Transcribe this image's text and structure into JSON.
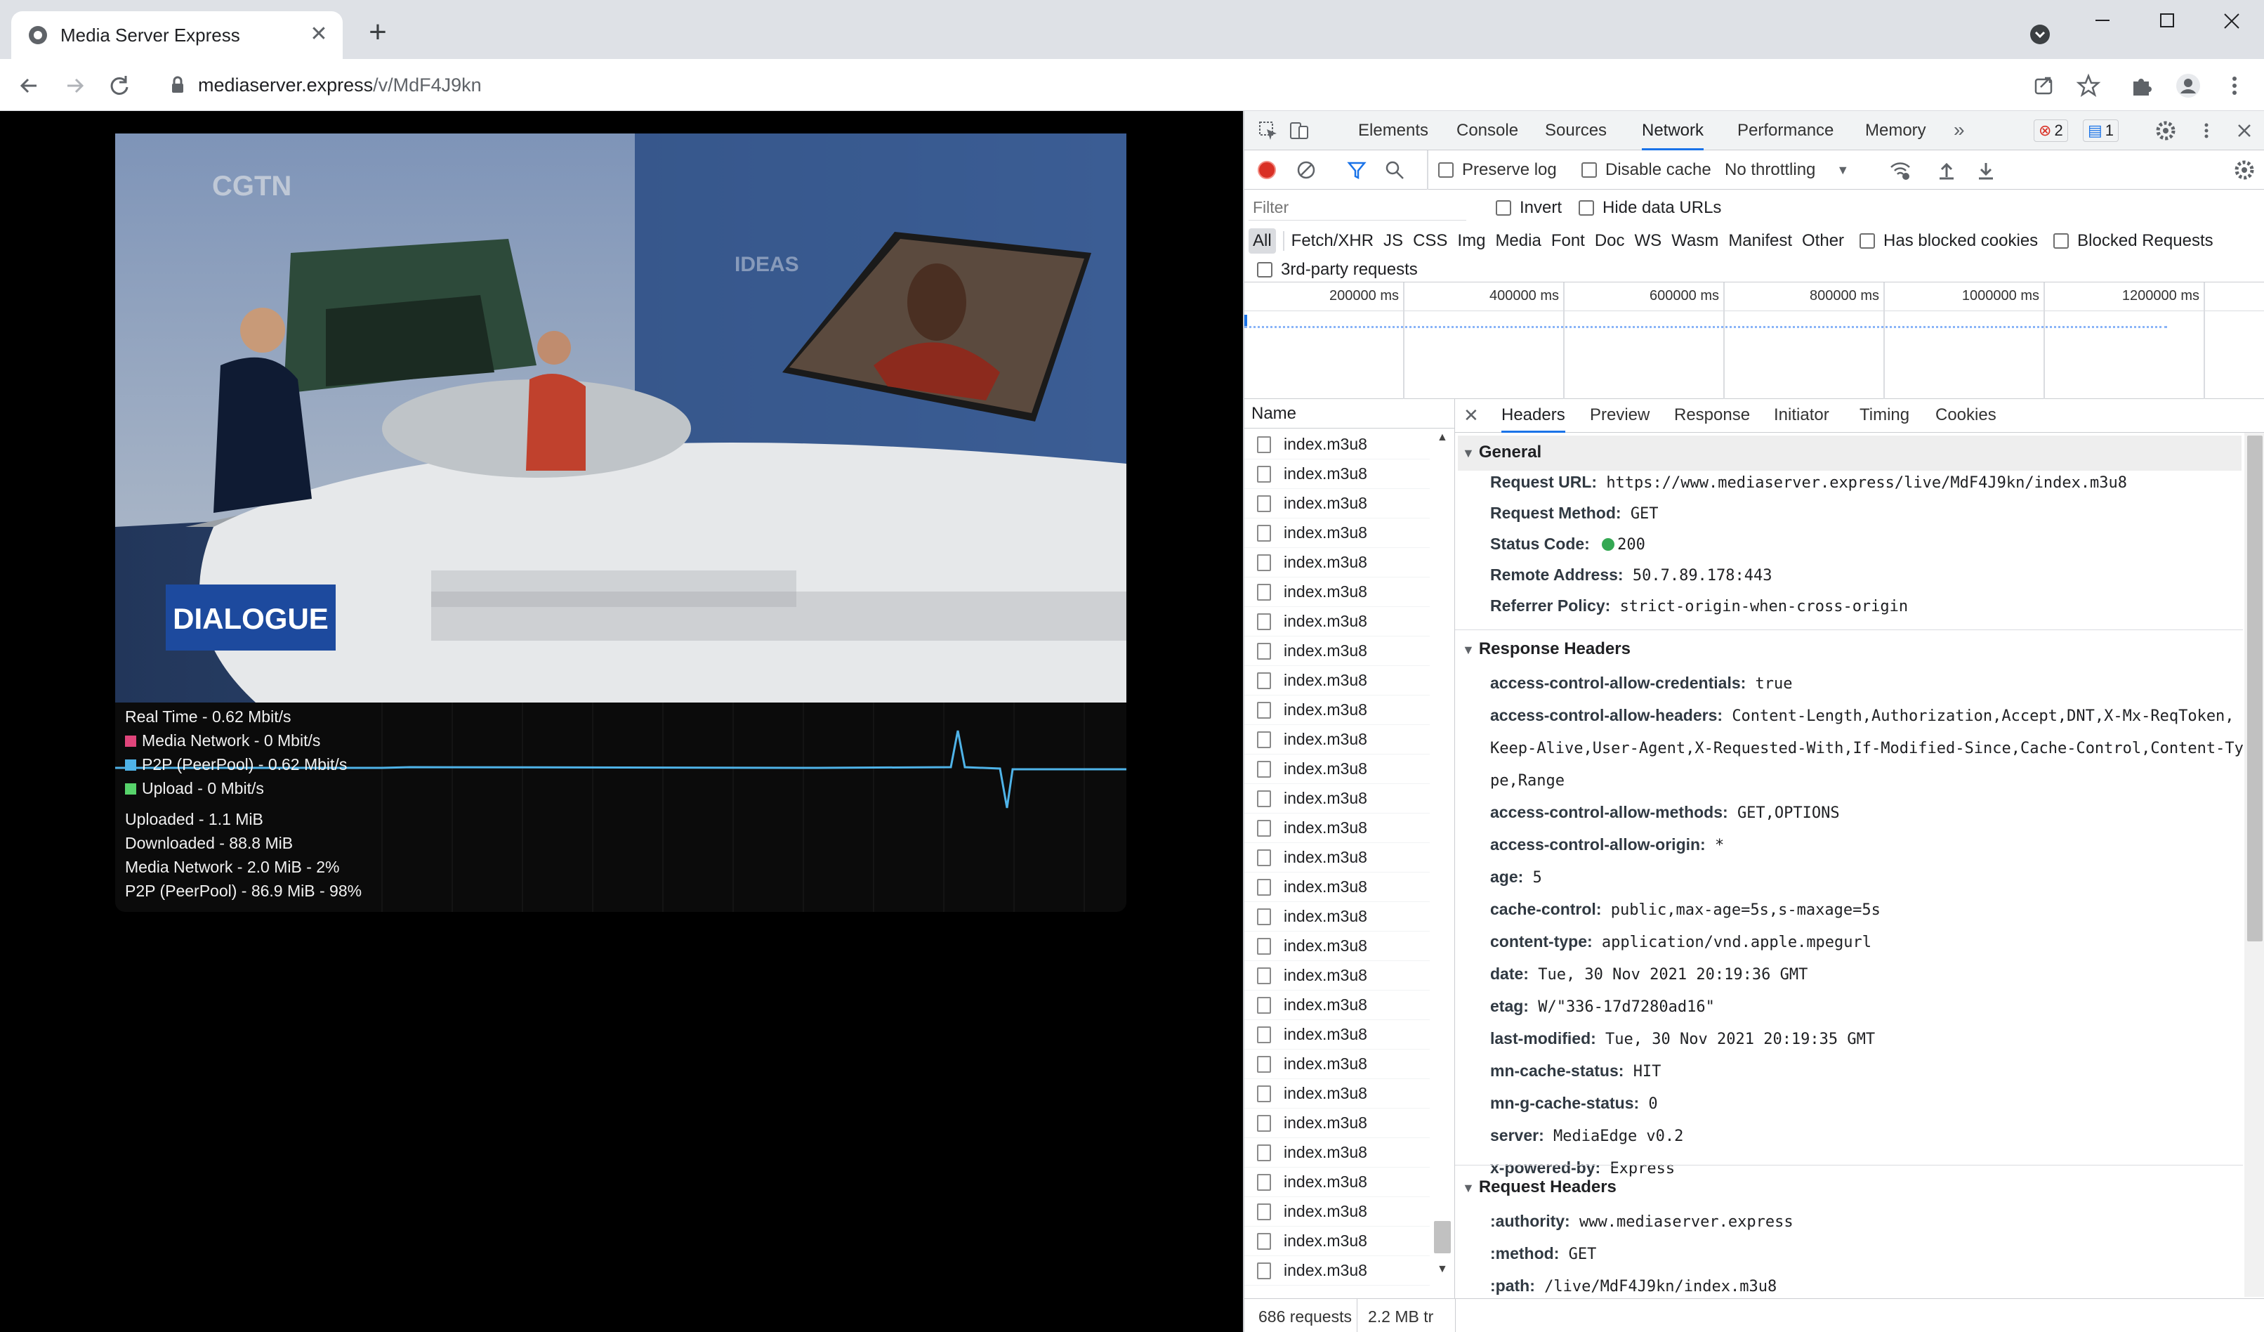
{
  "browser": {
    "tab_title": "Media Server Express",
    "url_host": "mediaserver.express",
    "url_path": "/v/MdF4J9kn"
  },
  "video": {
    "channel_logo": "CGTN",
    "background_text": "IDEAS",
    "program_badge": "DIALOGUE"
  },
  "stats": {
    "real_time": "Real Time - 0.62 Mbit/s",
    "media_network": "Media Network - 0 Mbit/s",
    "p2p": "P2P (PeerPool) - 0.62 Mbit/s",
    "upload": "Upload - 0 Mbit/s",
    "uploaded": "Uploaded - 1.1 MiB",
    "downloaded": "Downloaded - 88.8 MiB",
    "media_total": "Media Network - 2.0 MiB - 2%",
    "p2p_total": "P2P (PeerPool) - 86.9 MiB - 98%",
    "colors": {
      "media": "#e0457b",
      "p2p": "#4fb3e8",
      "upload": "#57d36b"
    }
  },
  "devtools": {
    "tabs": [
      "Elements",
      "Console",
      "Sources",
      "Network",
      "Performance",
      "Memory"
    ],
    "active_tab": "Network",
    "error_count": "2",
    "message_count": "1",
    "toolbar": {
      "preserve_log": "Preserve log",
      "disable_cache": "Disable cache",
      "throttling": "No throttling"
    },
    "filter": {
      "placeholder": "Filter",
      "invert": "Invert",
      "hide_data_urls": "Hide data URLs",
      "types": [
        "All",
        "Fetch/XHR",
        "JS",
        "CSS",
        "Img",
        "Media",
        "Font",
        "Doc",
        "WS",
        "Wasm",
        "Manifest",
        "Other"
      ],
      "has_blocked_cookies": "Has blocked cookies",
      "blocked_requests": "Blocked Requests",
      "third_party": "3rd-party requests"
    },
    "timeline_ticks": [
      "200000 ms",
      "400000 ms",
      "600000 ms",
      "800000 ms",
      "1000000 ms",
      "1200000 ms"
    ],
    "name_header": "Name",
    "request_name": "index.m3u8",
    "detail_tabs": [
      "Headers",
      "Preview",
      "Response",
      "Initiator",
      "Timing",
      "Cookies"
    ],
    "general": {
      "title": "General",
      "request_url_k": "Request URL:",
      "request_url_v": "https://www.mediaserver.express/live/MdF4J9kn/index.m3u8",
      "method_k": "Request Method:",
      "method_v": "GET",
      "status_k": "Status Code:",
      "status_v": "200",
      "remote_k": "Remote Address:",
      "remote_v": "50.7.89.178:443",
      "referrer_k": "Referrer Policy:",
      "referrer_v": "strict-origin-when-cross-origin"
    },
    "response_headers": {
      "title": "Response Headers",
      "rows": [
        {
          "k": "access-control-allow-credentials:",
          "v": "true"
        },
        {
          "k": "access-control-allow-headers:",
          "v": "Content-Length,Authorization,Accept,DNT,X-Mx-ReqToken,"
        },
        {
          "k": "",
          "v": "Keep-Alive,User-Agent,X-Requested-With,If-Modified-Since,Cache-Control,Content-Ty"
        },
        {
          "k": "",
          "v": "pe,Range"
        },
        {
          "k": "access-control-allow-methods:",
          "v": "GET,OPTIONS"
        },
        {
          "k": "access-control-allow-origin:",
          "v": "*"
        },
        {
          "k": "age:",
          "v": "5"
        },
        {
          "k": "cache-control:",
          "v": "public,max-age=5s,s-maxage=5s"
        },
        {
          "k": "content-type:",
          "v": "application/vnd.apple.mpegurl"
        },
        {
          "k": "date:",
          "v": "Tue, 30 Nov 2021 20:19:36 GMT"
        },
        {
          "k": "etag:",
          "v": "W/\"336-17d7280ad16\""
        },
        {
          "k": "last-modified:",
          "v": "Tue, 30 Nov 2021 20:19:35 GMT"
        },
        {
          "k": "mn-cache-status:",
          "v": "HIT"
        },
        {
          "k": "mn-g-cache-status:",
          "v": "0"
        },
        {
          "k": "server:",
          "v": "MediaEdge v0.2"
        },
        {
          "k": "x-powered-by:",
          "v": "Express"
        }
      ]
    },
    "request_headers": {
      "title": "Request Headers",
      "rows": [
        {
          "k": ":authority:",
          "v": "www.mediaserver.express"
        },
        {
          "k": ":method:",
          "v": "GET"
        },
        {
          "k": ":path:",
          "v": "/live/MdF4J9kn/index.m3u8"
        }
      ]
    },
    "status_requests": "686 requests",
    "status_transferred": "2.2 MB tr"
  }
}
